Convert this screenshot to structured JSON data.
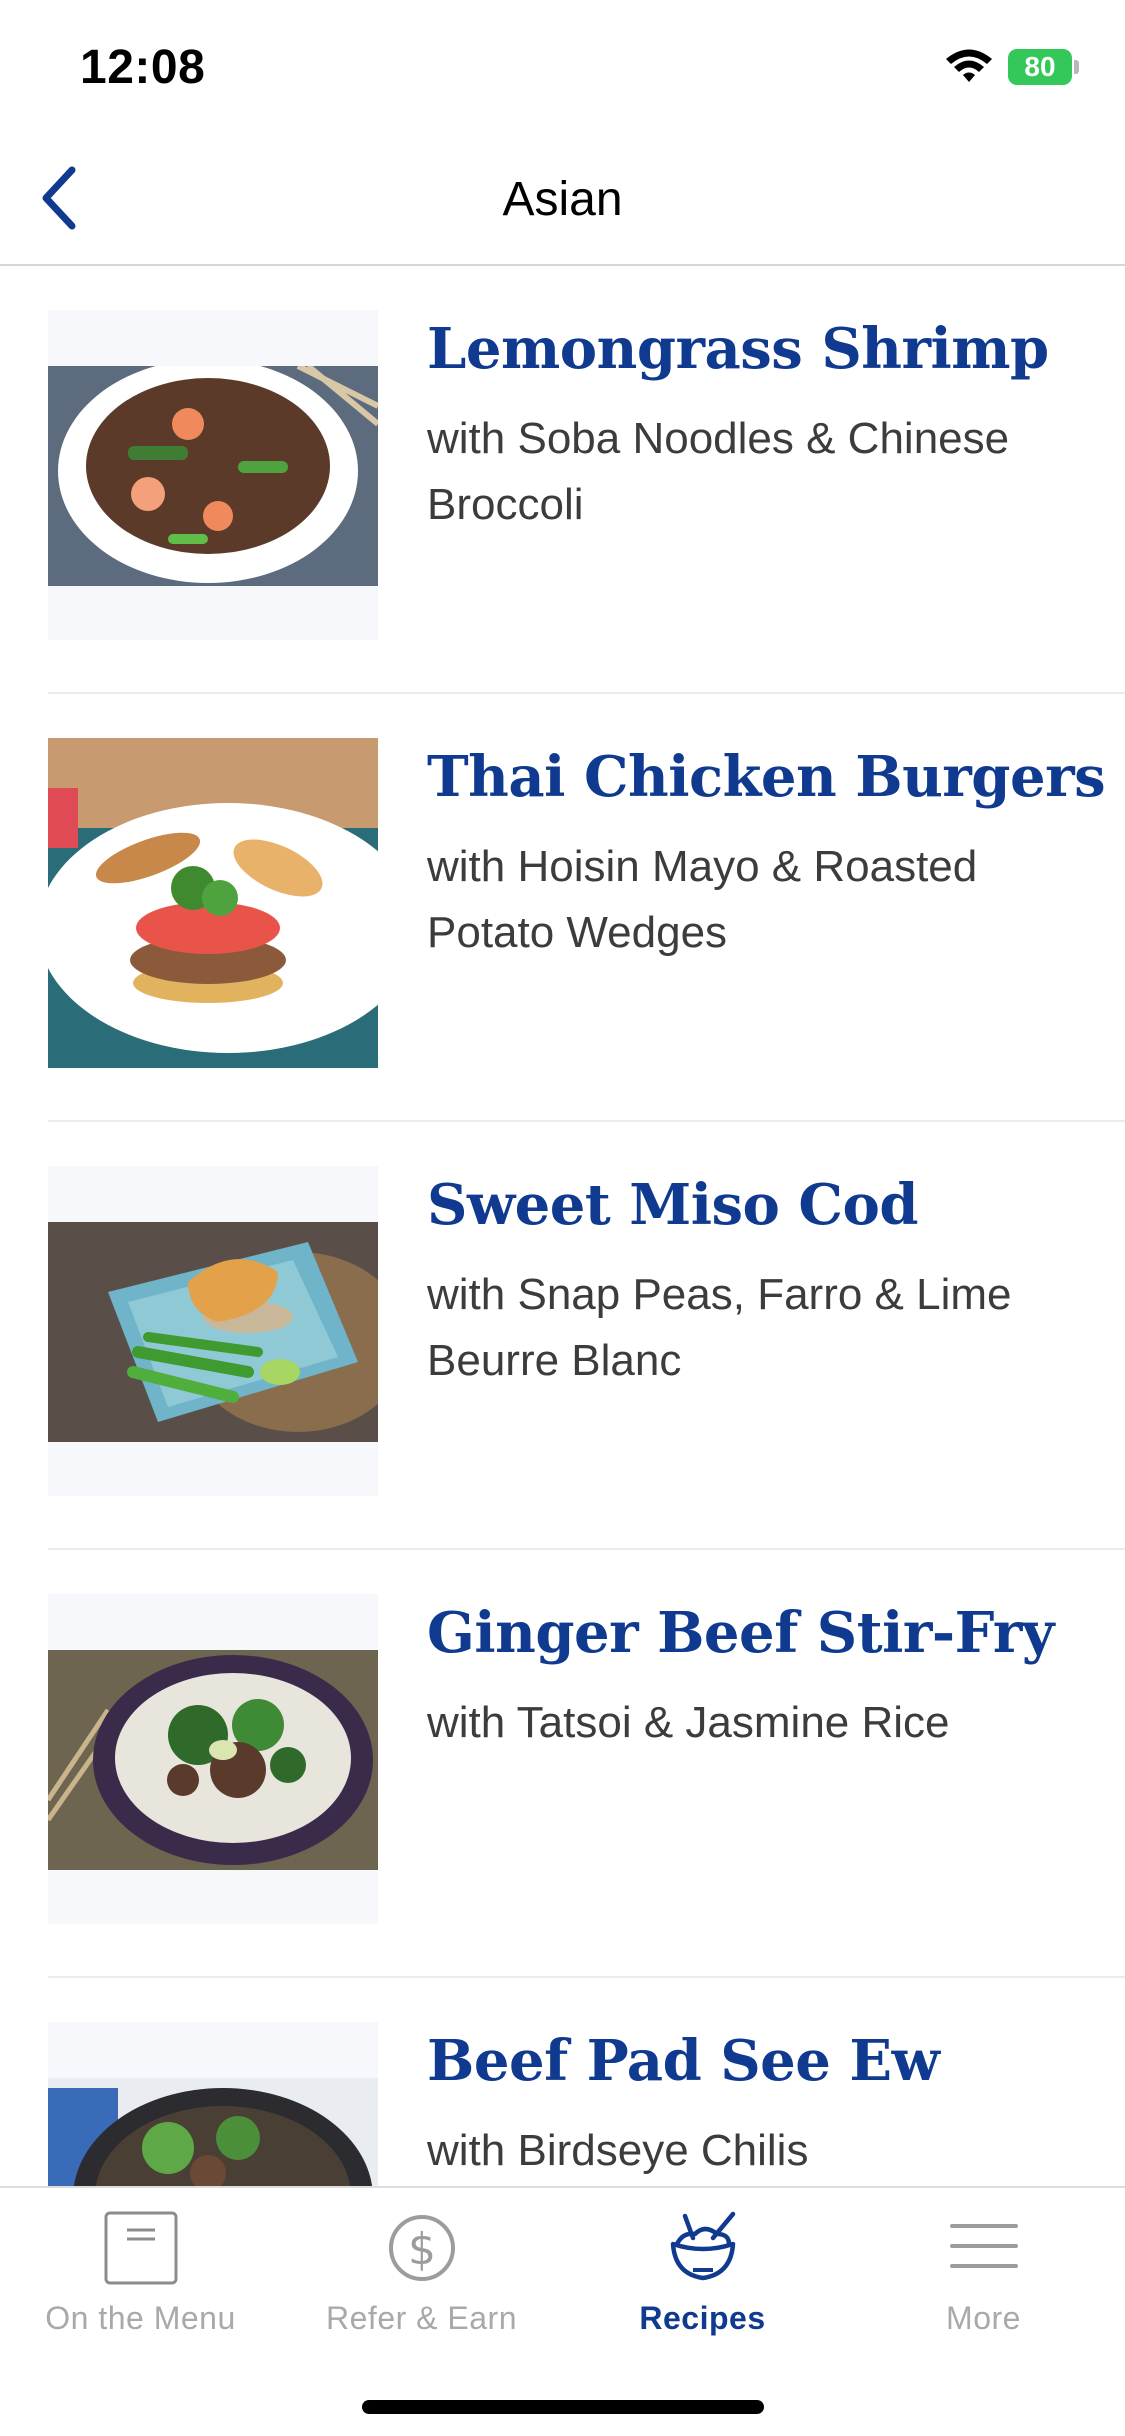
{
  "status": {
    "time": "12:08",
    "battery": "80"
  },
  "nav": {
    "title": "Asian"
  },
  "recipes": [
    {
      "title": "Lemongrass Shrimp",
      "subtitle": "with Soba Noodles & Chinese Broccoli"
    },
    {
      "title": "Thai Chicken Burgers",
      "subtitle": "with Hoisin Mayo & Roasted Potato Wedges"
    },
    {
      "title": "Sweet Miso Cod",
      "subtitle": "with Snap Peas, Farro & Lime Beurre Blanc"
    },
    {
      "title": "Ginger Beef Stir-Fry",
      "subtitle": "with Tatsoi & Jasmine Rice"
    },
    {
      "title": "Beef Pad See Ew",
      "subtitle": "with Birdseye Chilis"
    }
  ],
  "tabs": [
    {
      "label": "On the Menu",
      "icon": "menu-card-icon",
      "active": false
    },
    {
      "label": "Refer & Earn",
      "icon": "dollar-circle-icon",
      "active": false
    },
    {
      "label": "Recipes",
      "icon": "recipe-bowl-icon",
      "active": true
    },
    {
      "label": "More",
      "icon": "hamburger-icon",
      "active": false
    }
  ],
  "colors": {
    "brand": "#0f3a8f",
    "inactive": "#a9a9a9",
    "battery": "#34c759"
  }
}
